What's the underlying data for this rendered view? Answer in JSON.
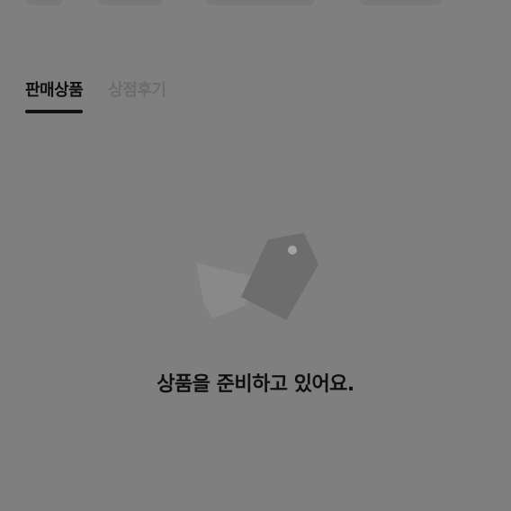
{
  "tabs": [
    {
      "label": "판매상품",
      "active": true
    },
    {
      "label": "상점후기",
      "active": false
    }
  ],
  "empty_state": {
    "icon": "price-tag-icon",
    "message": "상품을 준비하고 있어요."
  },
  "colors": {
    "overlay": "#7f7f7f",
    "active_tab": "#0d0d0d",
    "inactive_tab": "#6b6b6b",
    "underline": "#111111"
  }
}
